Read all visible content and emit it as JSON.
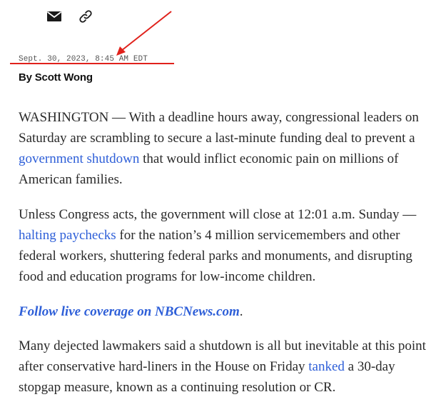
{
  "share": {
    "email_icon": "envelope-icon",
    "link_icon": "link-icon"
  },
  "dateline": "Sept. 30, 2023, 8:45 AM EDT",
  "byline": "By Scott Wong",
  "annotation": {
    "color": "#e0211b"
  },
  "article": {
    "p1": {
      "before": "WASHINGTON — With a deadline hours away, congressional leaders on Saturday are scrambling to secure a last-minute funding deal to prevent a ",
      "link": "government shutdown",
      "after": " that would inflict economic pain on millions of American families."
    },
    "p2": {
      "before": "Unless Congress acts, the government will close at 12:01 a.m. Sunday — ",
      "link": "halting paychecks",
      "after": " for the nation’s 4 million servicemembers and other federal workers, shuttering federal parks and monuments, and disrupting food and education programs for low-income children."
    },
    "p3": {
      "link": "Follow live coverage on NBCNews.com",
      "after": "."
    },
    "p4": {
      "before": "Many dejected lawmakers said a shutdown is all but inevitable at this point after conservative hard-liners in the House on Friday ",
      "link": "tanked",
      "after": " a 30-day stopgap measure, known as a continuing resolution or CR."
    }
  },
  "colors": {
    "link": "#2e5fd8",
    "text": "#2a2a2a"
  }
}
